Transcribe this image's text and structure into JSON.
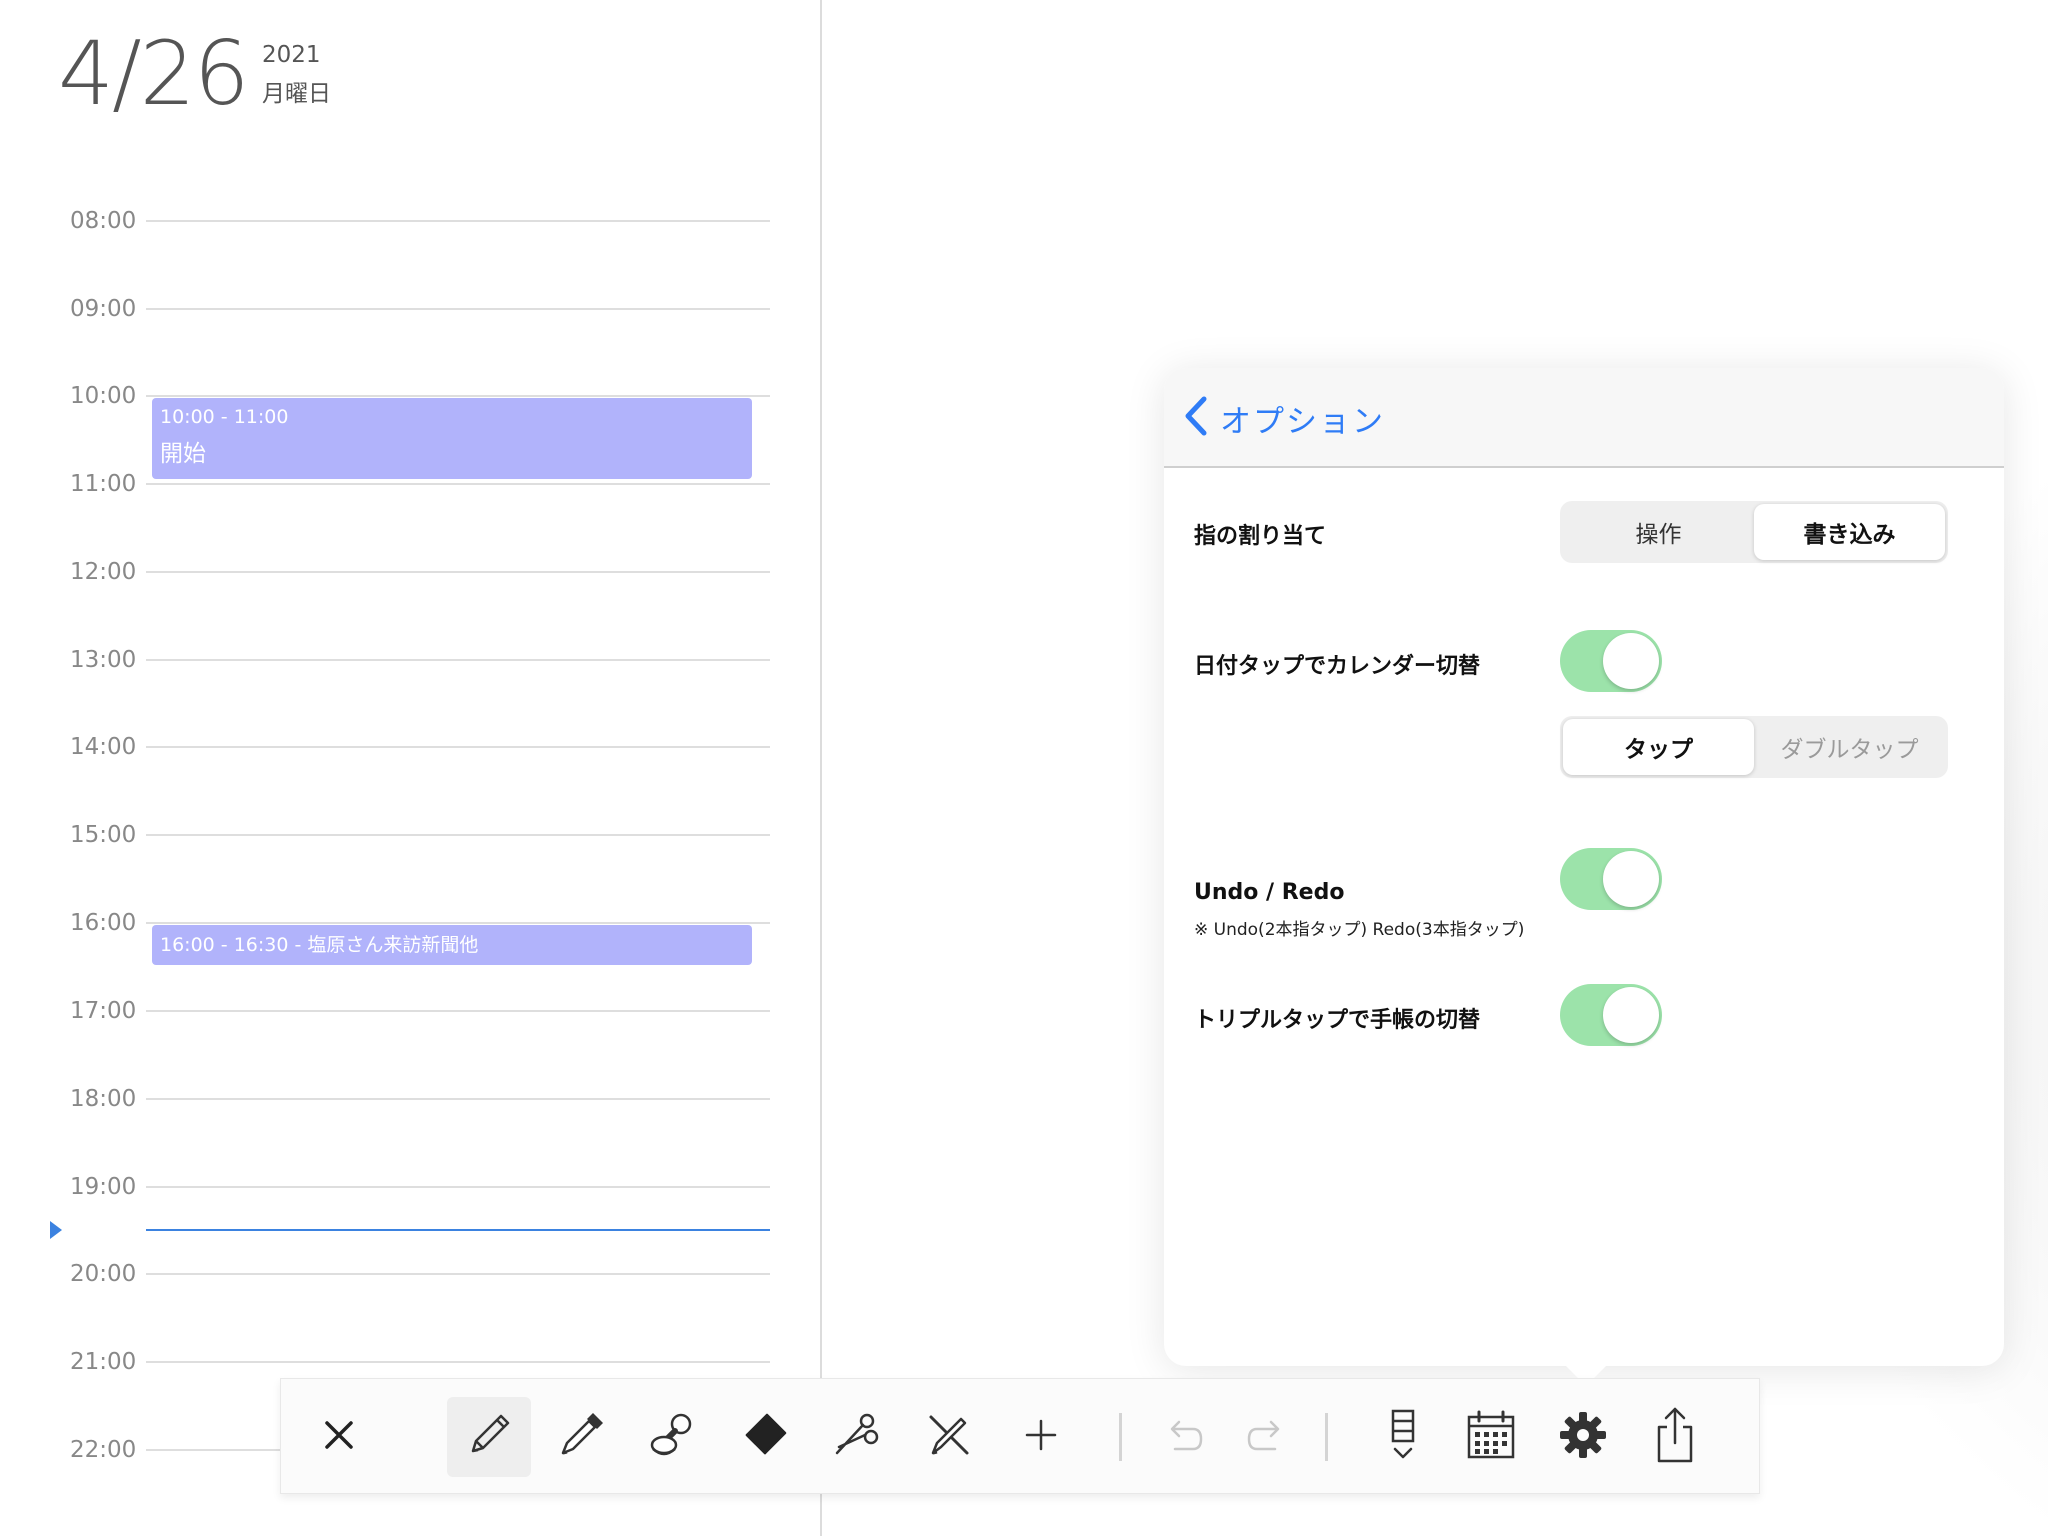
{
  "date": {
    "day": "4/26",
    "year": "2021",
    "weekday": "月曜日"
  },
  "schedule": {
    "hours": [
      "08:00",
      "09:00",
      "10:00",
      "11:00",
      "12:00",
      "13:00",
      "14:00",
      "15:00",
      "16:00",
      "17:00",
      "18:00",
      "19:00",
      "20:00",
      "21:00",
      "22:00"
    ],
    "events": [
      {
        "time": "10:00 - 11:00",
        "title": "開始"
      },
      {
        "text": "16:00 - 16:30 - 塩原さん来訪新聞他"
      }
    ]
  },
  "options_panel": {
    "back_label": "オプション",
    "finger_assignment": {
      "label": "指の割り当て",
      "options": [
        "操作",
        "書き込み"
      ],
      "selected": "書き込み"
    },
    "date_tap_calendar": {
      "label": "日付タップでカレンダー切替",
      "enabled": true,
      "options": [
        "タップ",
        "ダブルタップ"
      ],
      "selected": "タップ"
    },
    "undo_redo": {
      "label": "Undo / Redo",
      "note": "※ Undo(2本指タップ) Redo(3本指タップ)",
      "enabled": true
    },
    "triple_tap": {
      "label": "トリプルタップで手帳の切替",
      "enabled": true
    }
  },
  "toolbar": {
    "tools": [
      "close-icon",
      "pencil-icon",
      "pen-icon",
      "stamp-icon",
      "eraser-icon",
      "scissors-icon",
      "ruler-pen-icon",
      "plus-icon",
      "undo-icon",
      "redo-icon",
      "day-view-icon",
      "calendar-icon",
      "gear-icon",
      "share-icon"
    ],
    "active_tool": "pencil-icon"
  },
  "colors": {
    "accent": "#2f7cf6",
    "event": "#b1b3fb",
    "toggle_on": "#9ce3aa",
    "now_line": "#3b82e0"
  }
}
